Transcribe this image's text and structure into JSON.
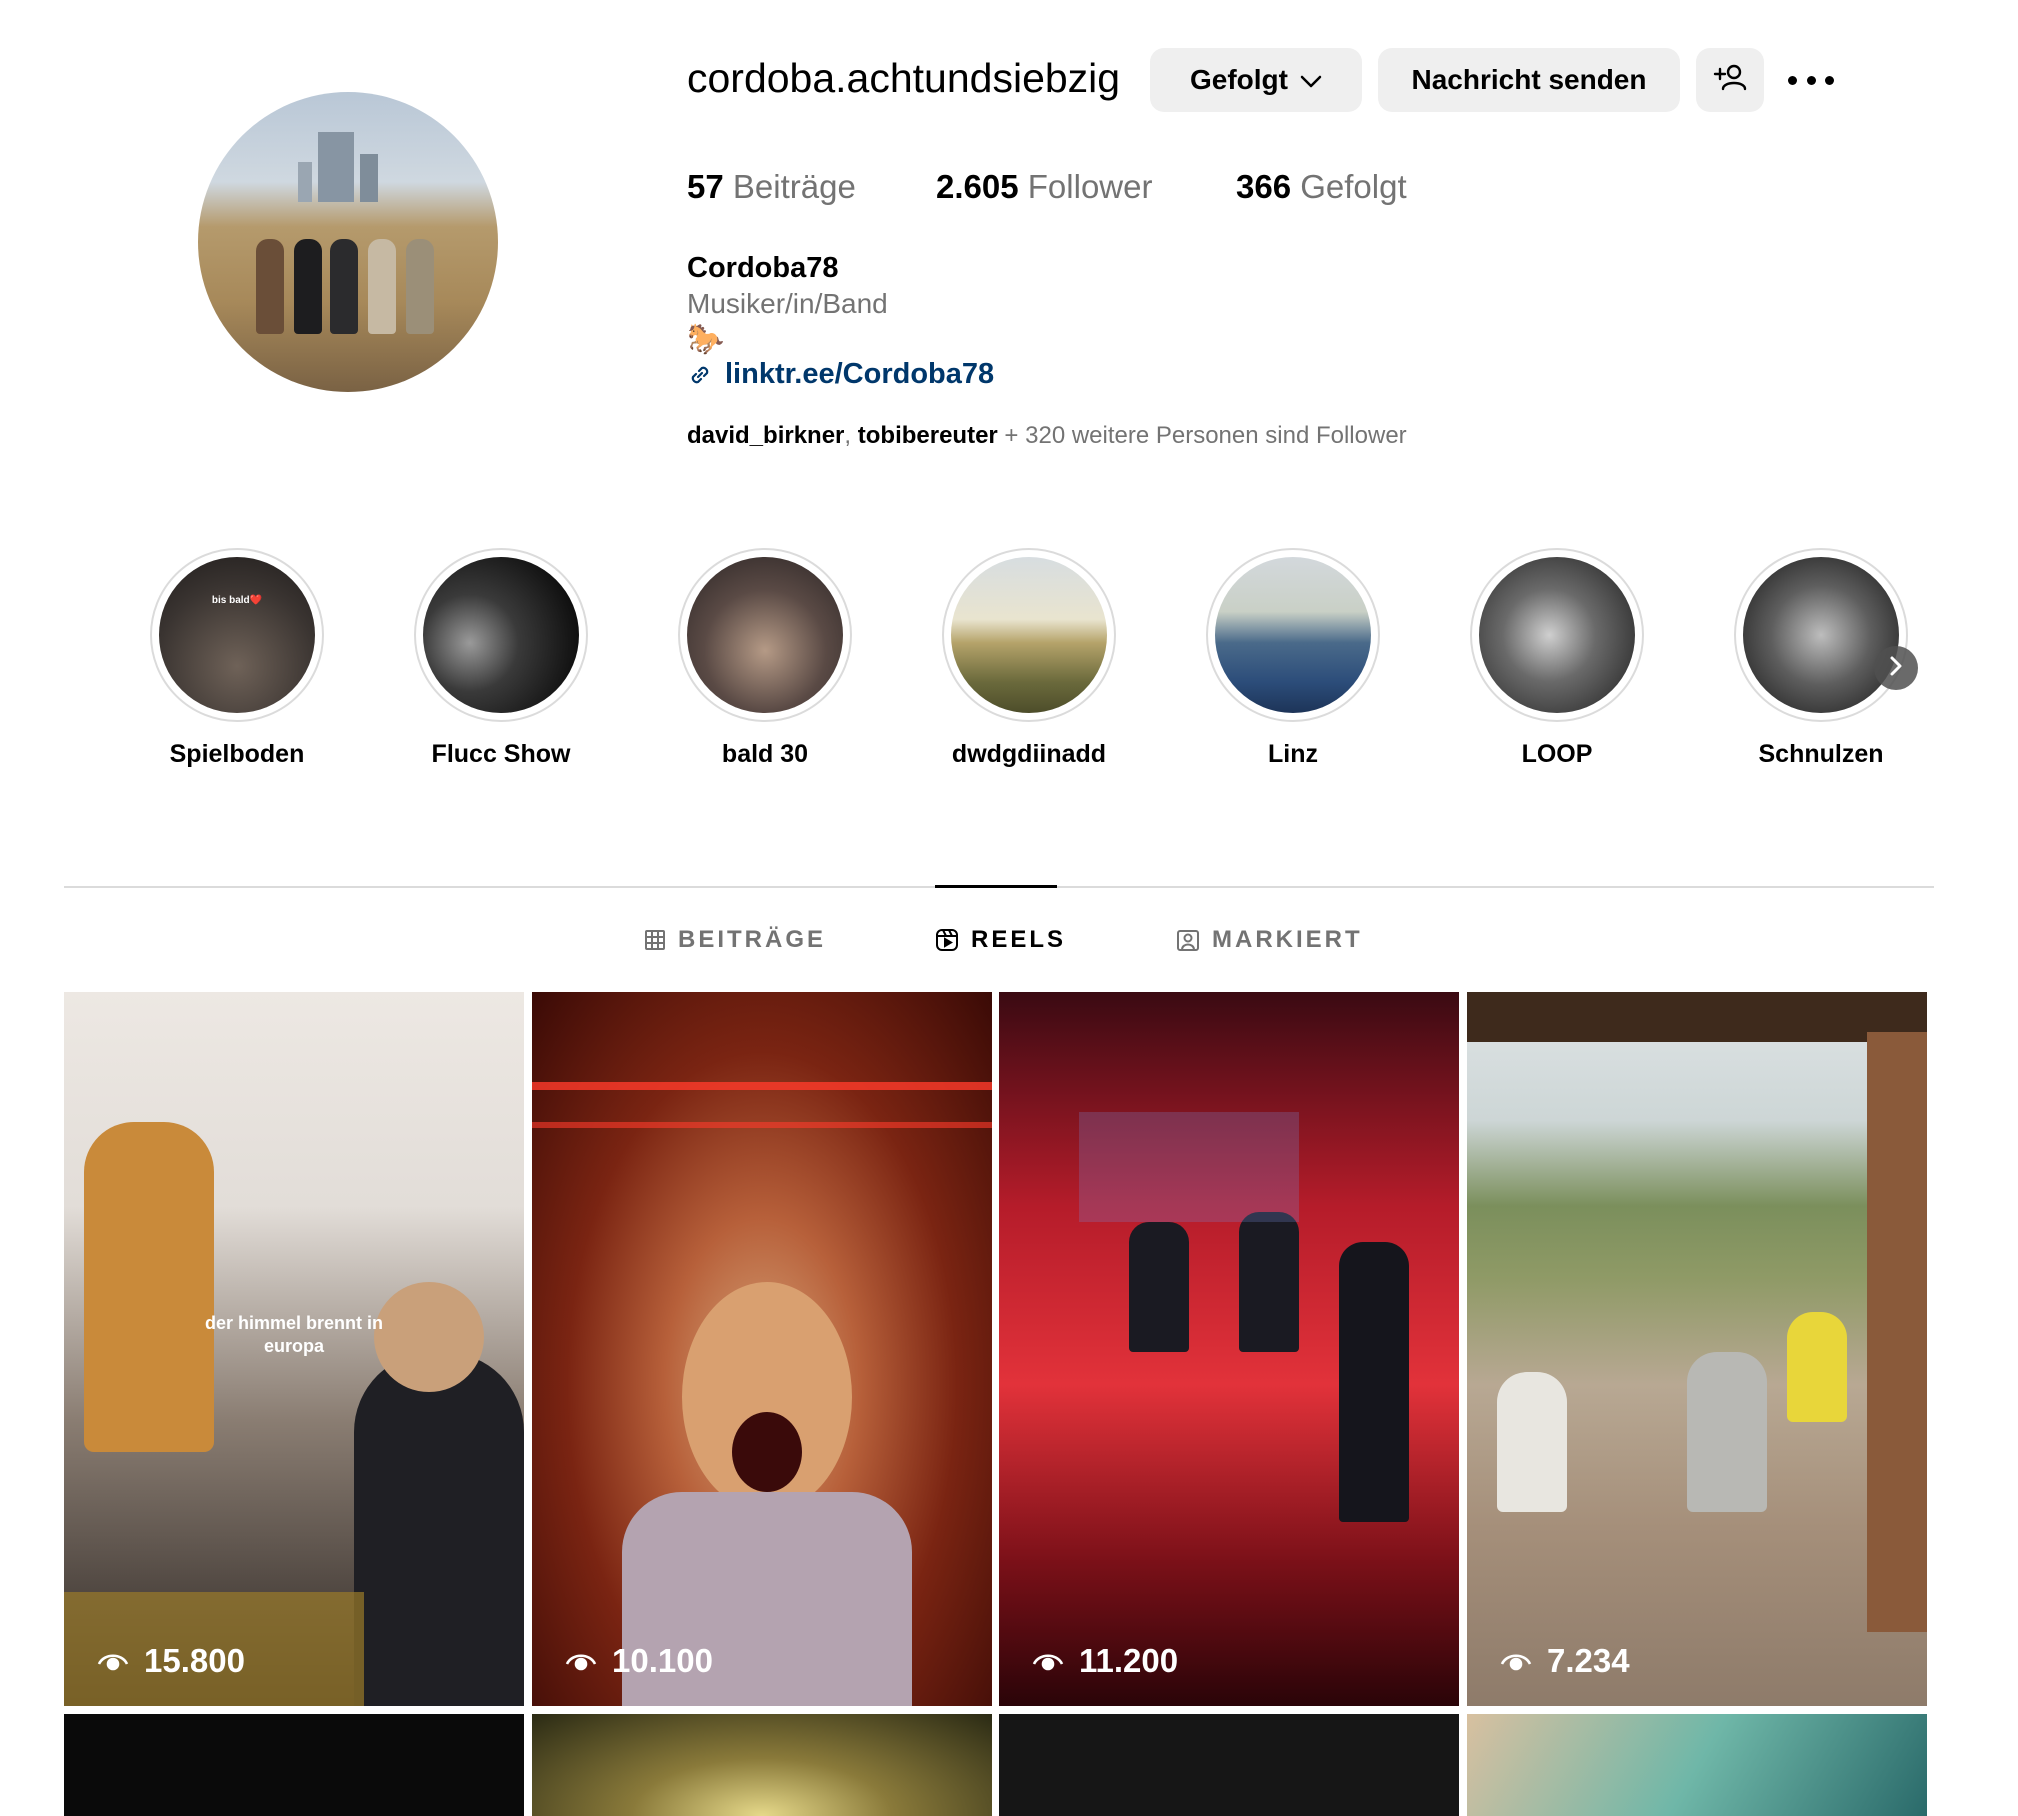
{
  "profile": {
    "username": "cordoba.achtundsiebzig",
    "follow_button": "Gefolgt",
    "message_button": "Nachricht senden",
    "posts_count": "57",
    "posts_label": "Beiträge",
    "followers_count": "2.605",
    "followers_label": "Follower",
    "following_count": "366",
    "following_label": "Gefolgt",
    "full_name": "Cordoba78",
    "category": "Musiker/in/Band",
    "bio_emoji": "🐎",
    "link": "linktr.ee/Cordoba78",
    "followed_by_1": "david_birkner",
    "followed_by_sep": ", ",
    "followed_by_2": "tobibereuter",
    "followed_by_rest": " + 320 weitere Personen sind Follower"
  },
  "highlights": [
    {
      "label": "Spielboden",
      "overlay": "bis bald❤️"
    },
    {
      "label": "Flucc Show"
    },
    {
      "label": "bald 30"
    },
    {
      "label": "dwdgdiinadd"
    },
    {
      "label": "Linz"
    },
    {
      "label": "LOOP"
    },
    {
      "label": "Schnulzen"
    }
  ],
  "tabs": {
    "posts": "BEITRÄGE",
    "reels": "REELS",
    "tagged": "MARKIERT"
  },
  "reels": [
    {
      "views": "15.800",
      "overlay_line1": "der himmel brennt in",
      "overlay_line2": "europa"
    },
    {
      "views": "10.100"
    },
    {
      "views": "11.200"
    },
    {
      "views": "7.234"
    }
  ],
  "icons": {
    "follow_chevron": "chevron-down-icon",
    "add_user": "add-user-icon",
    "more": "more-icon",
    "link": "link-icon",
    "grid": "grid-icon",
    "reels": "reels-icon",
    "tagged": "tagged-icon",
    "views": "eye-icon",
    "next": "chevron-right-icon"
  }
}
